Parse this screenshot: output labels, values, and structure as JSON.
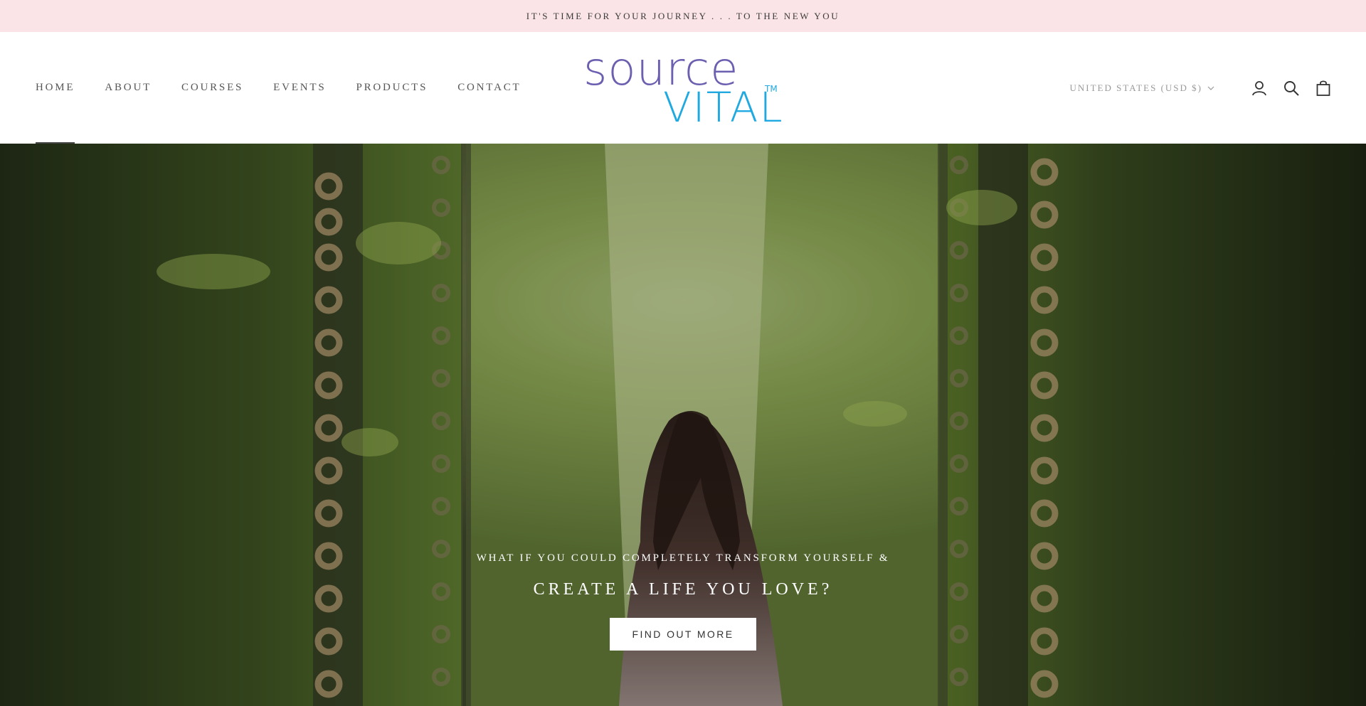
{
  "announcement": {
    "text": "IT'S TIME FOR YOUR JOURNEY . . . TO THE NEW YOU",
    "background": "#fbe4e7"
  },
  "header": {
    "nav": [
      {
        "label": "HOME",
        "active": true
      },
      {
        "label": "ABOUT",
        "active": false
      },
      {
        "label": "COURSES",
        "active": false
      },
      {
        "label": "EVENTS",
        "active": false
      },
      {
        "label": "PRODUCTS",
        "active": false
      },
      {
        "label": "CONTACT",
        "active": false
      }
    ],
    "logo": {
      "top_text": "source",
      "bottom_text": "VITAL",
      "trademark": "TM",
      "top_color": "#6b5fb0",
      "bottom_color": "#1fa9e0"
    },
    "currency": "UNITED STATES (USD $)",
    "icons": [
      "account-icon",
      "search-icon",
      "cart-icon"
    ]
  },
  "hero": {
    "kicker": "WHAT IF YOU COULD COMPLETELY TRANSFORM YOURSELF &",
    "title": "CREATE A LIFE YOU LOVE?",
    "button_label": "FIND OUT MORE"
  }
}
